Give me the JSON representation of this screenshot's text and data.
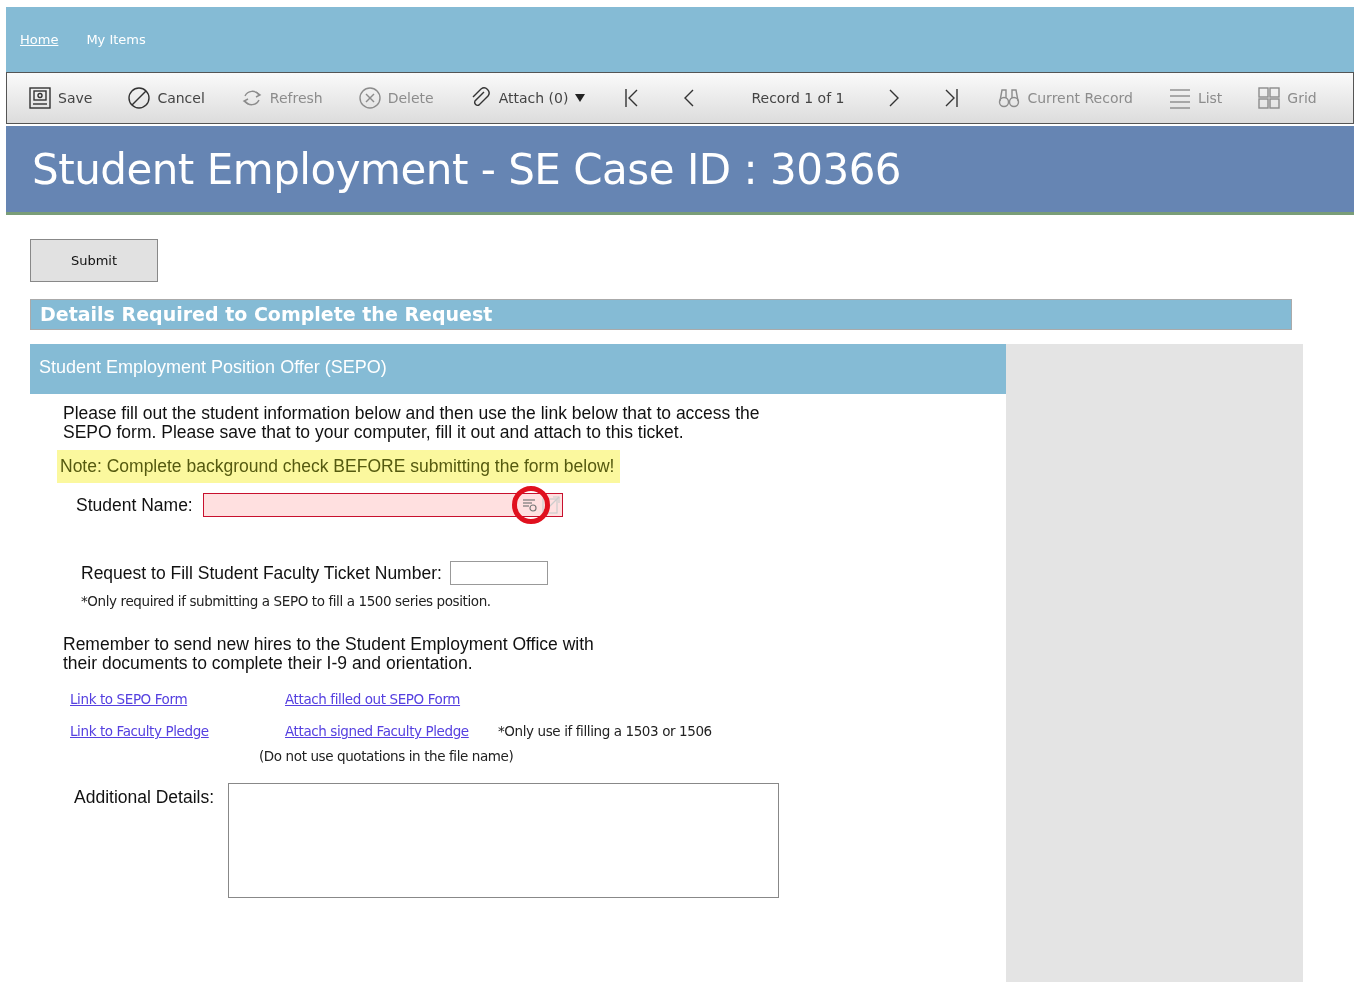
{
  "nav": [
    {
      "label": "Home",
      "selected": true
    },
    {
      "label": "My Items",
      "selected": false
    }
  ],
  "toolbar": [
    {
      "kind": "save",
      "label": "Save",
      "disabled": false
    },
    {
      "kind": "cancel",
      "label": "Cancel",
      "disabled": false
    },
    {
      "kind": "refresh",
      "label": "Refresh",
      "disabled": true
    },
    {
      "kind": "delete",
      "label": "Delete",
      "disabled": true
    },
    {
      "kind": "attach",
      "label": "Attach (0)",
      "disabled": false
    },
    {
      "kind": "first",
      "disabled": false
    },
    {
      "kind": "prev",
      "disabled": false
    },
    {
      "kind": "record",
      "label": "Record 1 of 1"
    },
    {
      "kind": "next",
      "disabled": false
    },
    {
      "kind": "last",
      "disabled": false
    },
    {
      "kind": "current",
      "label": "Current Record",
      "disabled": true
    },
    {
      "kind": "list",
      "label": "List",
      "disabled": true
    },
    {
      "kind": "grid",
      "label": "Grid",
      "disabled": true
    }
  ],
  "page_title": "Student Employment - SE Case ID : 30366",
  "submit_button": "Submit",
  "section_title": "Details Required to Complete the Request",
  "subsection_title": "Student Employment Position Offer (SEPO)",
  "intro": "Please fill out the student information below and then use the link below that to access the SEPO form. Please save that to your computer, fill it out and attach to this ticket.",
  "note": "Note: Complete background check BEFORE submitting the form below!",
  "student_name": {
    "label": "Student Name:",
    "required": true,
    "lookup_highlighted": true
  },
  "ticket_number": {
    "label": "Request to Fill Student Faculty Ticket Number:",
    "hint": "*Only required if submitting a SEPO to fill a 1500 series position."
  },
  "reminder": "Remember to send new hires to the Student Employment Office with their documents to complete their I-9 and orientation.",
  "links": [
    [
      "Link to SEPO Form",
      "Attach filled out SEPO Form"
    ],
    [
      "Link to Faculty Pledge",
      "Attach signed Faculty Pledge"
    ]
  ],
  "pledge_note": "*Only use if filling a 1503 or 1506",
  "file_note": "(Do not use quotations in the file name)",
  "additional_details": {
    "label": "Additional Details:"
  }
}
